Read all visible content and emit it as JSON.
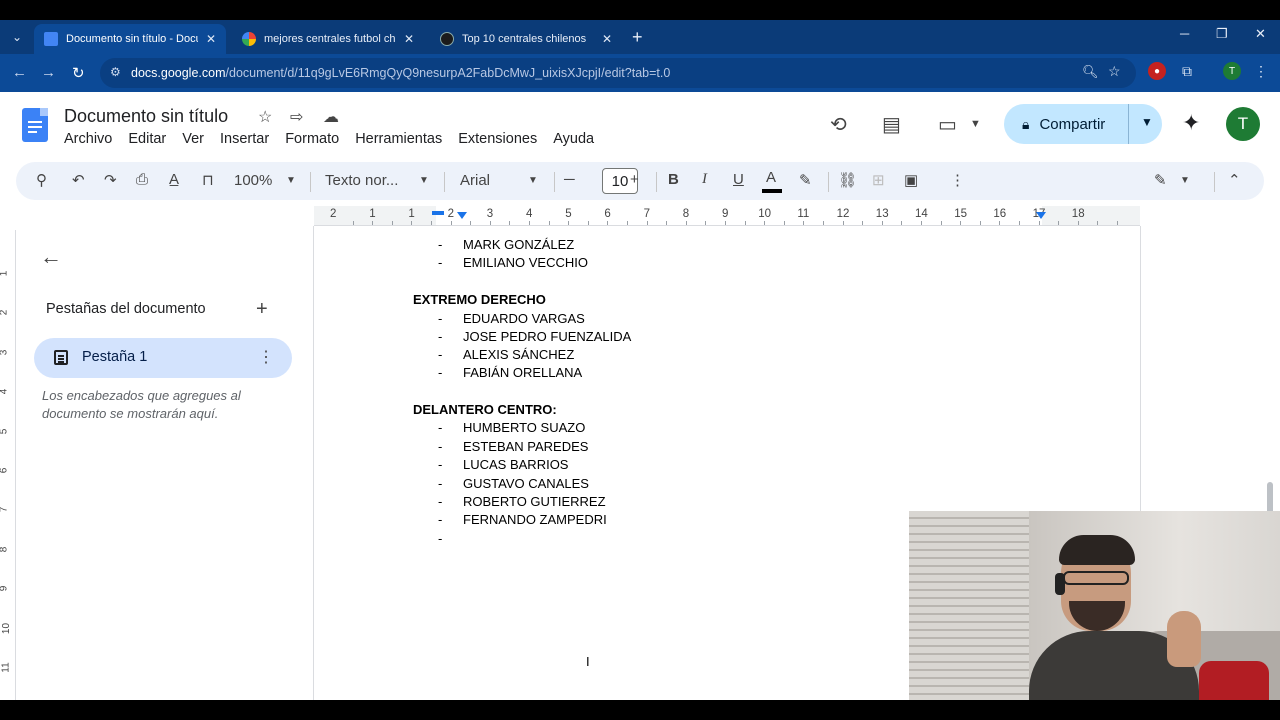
{
  "browser": {
    "tabs": [
      {
        "label": "Documento sin título - Docume",
        "active": true,
        "icon": "google-docs-icon"
      },
      {
        "label": "mejores centrales futbol chilenos",
        "active": false,
        "icon": "google-g-icon"
      },
      {
        "label": "Top 10 centrales chilenos",
        "active": false,
        "icon": "openai-icon"
      }
    ],
    "url_host": "docs.google.com",
    "url_path": "/document/d/11q9gLvE6RmgQyQ9nesurpA2FabDcMwJ_uixisXJcpjI/edit?tab=t.0",
    "profile_initial": "T"
  },
  "docs": {
    "title": "Documento sin título",
    "menu": [
      "Archivo",
      "Editar",
      "Ver",
      "Insertar",
      "Formato",
      "Herramientas",
      "Extensiones",
      "Ayuda"
    ],
    "share_label": "Compartir",
    "avatar_initial": "T"
  },
  "toolbar": {
    "zoom": "100%",
    "style": "Texto nor...",
    "font": "Arial",
    "font_size": "10"
  },
  "ruler": {
    "numbers": [
      "2",
      "1",
      "1",
      "2",
      "3",
      "4",
      "5",
      "6",
      "7",
      "8",
      "9",
      "10",
      "11",
      "12",
      "13",
      "14",
      "15",
      "16",
      "17",
      "18"
    ],
    "vertical_numbers": [
      "1",
      "2",
      "3",
      "4",
      "5",
      "6",
      "7",
      "8",
      "9",
      "10",
      "11"
    ]
  },
  "sidebar": {
    "title": "Pestañas del documento",
    "tab_name": "Pestaña 1",
    "note": "Los encabezados que agregues al documento se mostrarán aquí."
  },
  "document": {
    "top_items": [
      "MARK GONZÁLEZ",
      "EMILIANO VECCHIO"
    ],
    "sections": [
      {
        "heading": "EXTREMO DERECHO",
        "items": [
          "EDUARDO VARGAS",
          "JOSE PEDRO FUENZALIDA",
          "ALEXIS SÁNCHEZ",
          "FABIÁN ORELLANA"
        ]
      },
      {
        "heading": "DELANTERO CENTRO:",
        "items": [
          "HUMBERTO SUAZO",
          "ESTEBAN PAREDES",
          "LUCAS BARRIOS",
          "GUSTAVO CANALES",
          "ROBERTO GUTIERREZ",
          "FERNANDO ZAMPEDRI",
          ""
        ]
      }
    ],
    "bullet": "-"
  }
}
